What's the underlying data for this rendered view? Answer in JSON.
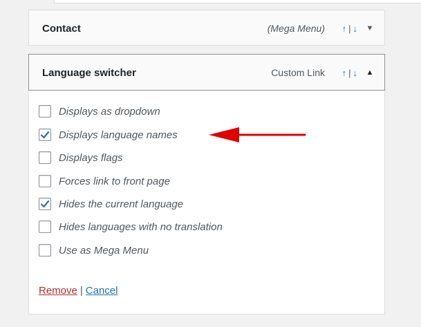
{
  "contact_item": {
    "title": "Contact",
    "type": "(Mega Menu)",
    "order_up": "↑",
    "order_sep": "|",
    "order_down": "↓",
    "toggle": "▼"
  },
  "lang_item": {
    "title": "Language switcher",
    "type": "Custom Link",
    "order_up": "↑",
    "order_sep": "|",
    "order_down": "↓",
    "toggle": "▲"
  },
  "options": [
    {
      "label": "Displays as dropdown",
      "checked": false
    },
    {
      "label": "Displays language names",
      "checked": true
    },
    {
      "label": "Displays flags",
      "checked": false
    },
    {
      "label": "Forces link to front page",
      "checked": false
    },
    {
      "label": "Hides the current language",
      "checked": true
    },
    {
      "label": "Hides languages with no translation",
      "checked": false
    },
    {
      "label": "Use as Mega Menu",
      "checked": false
    }
  ],
  "actions": {
    "remove": "Remove",
    "separator": "|",
    "cancel": "Cancel"
  },
  "colors": {
    "checkmark": "#2271b1",
    "arrow": "#e00000",
    "remove": "#b32d2e",
    "cancel": "#2271b1"
  },
  "annotation": {
    "icon": "red-arrow-left-icon"
  }
}
